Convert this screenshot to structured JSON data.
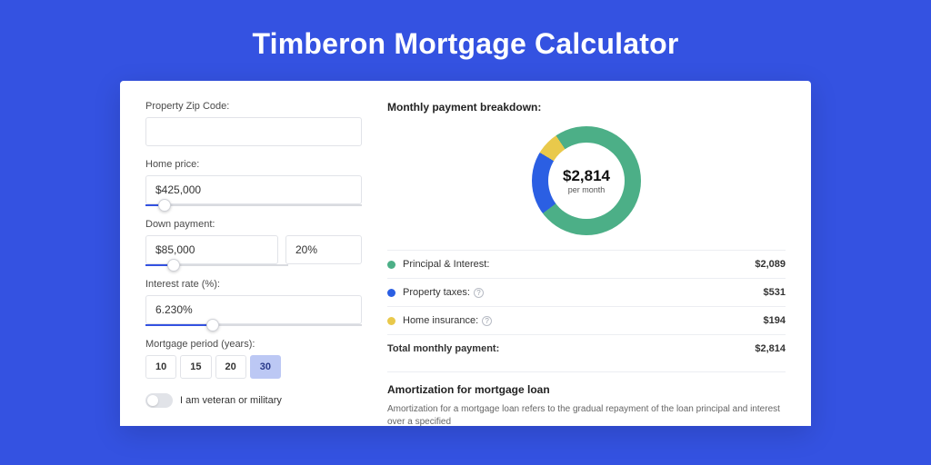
{
  "title": "Timberon Mortgage Calculator",
  "form": {
    "zip": {
      "label": "Property Zip Code:",
      "value": ""
    },
    "home_price": {
      "label": "Home price:",
      "value": "$425,000",
      "slider_pct": 9
    },
    "down_payment": {
      "label": "Down payment:",
      "value": "$85,000",
      "pct_value": "20%",
      "slider_pct": 20
    },
    "interest": {
      "label": "Interest rate (%):",
      "value": "6.230%",
      "slider_pct": 31
    },
    "period": {
      "label": "Mortgage period (years):",
      "options": [
        "10",
        "15",
        "20",
        "30"
      ],
      "active": "30"
    },
    "veteran": {
      "label": "I am veteran or military",
      "on": false
    }
  },
  "breakdown": {
    "title": "Monthly payment breakdown:",
    "donut": {
      "amount": "$2,814",
      "sub": "per month"
    },
    "items": [
      {
        "name": "Principal & Interest:",
        "value": "$2,089",
        "color": "#4caf87",
        "info": false
      },
      {
        "name": "Property taxes:",
        "value": "$531",
        "color": "#2b5fe3",
        "info": true
      },
      {
        "name": "Home insurance:",
        "value": "$194",
        "color": "#e9c94b",
        "info": true
      }
    ],
    "total": {
      "name": "Total monthly payment:",
      "value": "$2,814"
    }
  },
  "amort": {
    "title": "Amortization for mortgage loan",
    "text": "Amortization for a mortgage loan refers to the gradual repayment of the loan principal and interest over a specified"
  },
  "chart_data": {
    "type": "pie",
    "title": "Monthly payment breakdown",
    "categories": [
      "Principal & Interest",
      "Property taxes",
      "Home insurance"
    ],
    "values": [
      2089,
      531,
      194
    ],
    "colors": [
      "#4caf87",
      "#2b5fe3",
      "#e9c94b"
    ],
    "total": 2814,
    "center_label": "$2,814 per month"
  }
}
